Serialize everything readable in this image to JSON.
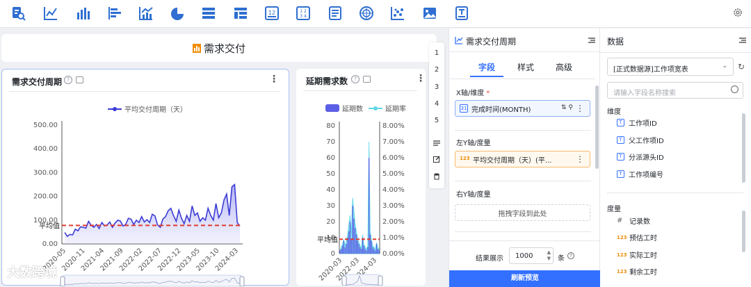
{
  "toolbar": {
    "icons": [
      "data-report-icon",
      "line-chart-icon",
      "bar-chart-icon",
      "horizontal-bar-chart-icon",
      "combo-chart-icon",
      "pie-chart-icon",
      "table-icon",
      "pivot-table-icon",
      "kpi-number-icon",
      "multi-kpi-icon",
      "text-list-icon",
      "radar-chart-icon",
      "scatter-chart-icon",
      "image-icon",
      "rich-text-icon"
    ],
    "settings_icon": "gear-icon"
  },
  "dashboard": {
    "title": "需求交付",
    "float_numbers": [
      "1",
      "2",
      "3",
      "4",
      "5"
    ]
  },
  "card1": {
    "title": "需求交付周期",
    "legend": "平均交付周期（天）",
    "avg_label": "平均值",
    "y_ticks": [
      "500.00",
      "400.00",
      "300.00",
      "200.00",
      "100.00",
      "0.00"
    ],
    "x_ticks": [
      "2020-05",
      "2020-11",
      "2021-04",
      "2021-09",
      "2022-02",
      "2022-07",
      "2022-12",
      "2023-05",
      "2023-10",
      "2024-03"
    ]
  },
  "card2": {
    "title": "延期需求数",
    "legend_bar": "延期数",
    "legend_area": "延期率",
    "avg_label": "平均值",
    "y_left": [
      "80",
      "70",
      "60",
      "50",
      "40",
      "30",
      "20",
      "10",
      "0"
    ],
    "y_right": [
      "8.00%",
      "7.00%",
      "6.00%",
      "5.00%",
      "4.00%",
      "3.00%",
      "2.00%",
      "1.00%",
      "0.00%"
    ],
    "x_ticks": [
      "2020-03",
      "2022-03",
      "2024-03"
    ]
  },
  "chart_data": [
    {
      "type": "line",
      "title": "需求交付周期",
      "series": [
        {
          "name": "平均交付周期（天）",
          "values": [
            48,
            32,
            40,
            38,
            62,
            55,
            72,
            70,
            66,
            95,
            78,
            70,
            82,
            65,
            90,
            76,
            80,
            92,
            70,
            88,
            100,
            96,
            75,
            82,
            108,
            104,
            82,
            100,
            90,
            115,
            92,
            102,
            90,
            125,
            118,
            80,
            70,
            105,
            115,
            140,
            150,
            120,
            95,
            142,
            108,
            85,
            120,
            95,
            160,
            120,
            130,
            95,
            110,
            100,
            150,
            120,
            100,
            170,
            110,
            130,
            185,
            210,
            120,
            240,
            250,
            90,
            75
          ]
        }
      ],
      "average": 78,
      "x": [
        "2020-05",
        "2020-11",
        "2021-04",
        "2021-09",
        "2022-02",
        "2022-07",
        "2022-12",
        "2023-05",
        "2023-10",
        "2024-03"
      ],
      "ylim": [
        0,
        500
      ]
    },
    {
      "type": "bar",
      "title": "延期需求数",
      "series": [
        {
          "name": "延期数",
          "values": [
            2,
            3,
            5,
            8,
            4,
            6,
            10,
            14,
            20,
            9,
            30,
            22,
            16,
            12,
            8,
            6,
            4,
            3,
            10,
            5,
            3,
            2,
            4,
            60,
            12,
            8,
            4,
            3,
            2,
            6,
            3,
            2
          ]
        },
        {
          "name": "延期率",
          "values": [
            0.2,
            0.4,
            0.6,
            0.9,
            0.5,
            0.8,
            1.2,
            1.8,
            2.4,
            1.2,
            3.5,
            2.8,
            1.9,
            1.4,
            1.0,
            0.7,
            0.5,
            0.4,
            1.2,
            0.6,
            0.4,
            0.3,
            0.5,
            7.0,
            1.4,
            0.9,
            0.5,
            0.4,
            0.3,
            0.7,
            0.4,
            0.3
          ]
        }
      ],
      "x": [
        "2020-03",
        "2022-03",
        "2024-03"
      ],
      "ylim_left": [
        0,
        80
      ],
      "ylim_right": [
        0,
        8
      ]
    }
  ],
  "panel": {
    "title": "需求交付周期",
    "tabs": [
      "字段",
      "样式",
      "高级"
    ],
    "x_axis_label": "X轴/维度",
    "required_mark": "*",
    "x_field": "完成时间(MONTH)",
    "x_field_chip": "31",
    "left_y_label": "左Y轴/度量",
    "left_y_field": "平均交付周期（天）(平...",
    "num_chip": "123",
    "right_y_label": "右Y轴/度量",
    "drop_hint": "拖拽字段到此处",
    "result_label": "结果展示",
    "result_value": "1000",
    "result_unit": "条",
    "refresh": "刷新预览"
  },
  "data_panel": {
    "title": "数据",
    "source": "[正式数据源]工作项宽表",
    "search_placeholder": "请输入字段名称搜索",
    "dim_label": "维度",
    "dims": [
      "工作项ID",
      "父工作项ID",
      "分派源头ID",
      "工作项编号"
    ],
    "measure_label": "度量",
    "measures": [
      "记录数",
      "预估工时",
      "实际工时",
      "剩余工时"
    ],
    "hash_chip": "#",
    "t_chip": "T"
  },
  "watermark": "大数跨境",
  "colors": {
    "primary": "#3370ff",
    "line": "#3b3bd6",
    "avg": "#e23a2e",
    "bar": "#5b5fe6",
    "area": "#5fd8e8"
  }
}
